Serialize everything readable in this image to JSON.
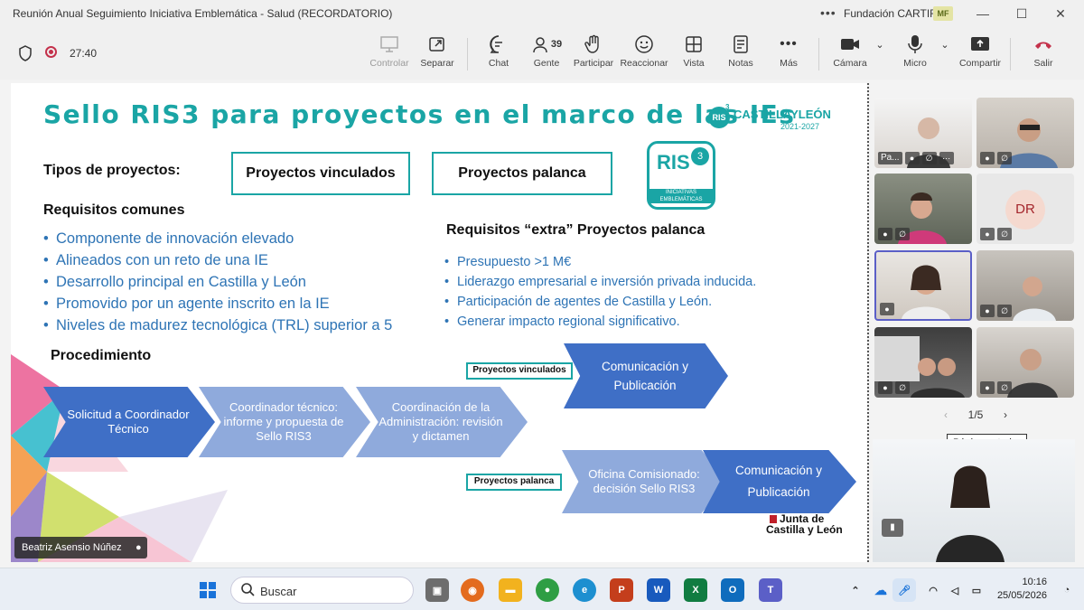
{
  "window": {
    "title": "Reunión Anual Seguimiento Iniciativa Emblemática - Salud (RECORDATORIO)",
    "more": "•••",
    "org": "Fundación CARTIF",
    "user_initials": "MF"
  },
  "meeting": {
    "timer": "27:40",
    "buttons": {
      "controlar": "Controlar",
      "separar": "Separar",
      "chat": "Chat",
      "gente": "Gente",
      "people_count": "39",
      "participar": "Participar",
      "reaccionar": "Reaccionar",
      "vista": "Vista",
      "notas": "Notas",
      "mas": "Más",
      "camara": "Cámara",
      "micro": "Micro",
      "compartir": "Compartir",
      "salir": "Salir"
    }
  },
  "slide": {
    "title": "Sello RIS3 para proyectos en el marco de las IEs",
    "logo_ris": "RIS",
    "logo_sup": "3",
    "logo_region": "CASTILLAYLEÓN",
    "logo_years": "2021-2027",
    "badge_ris": "RIS",
    "badge_three": "3",
    "badge_text": "INICIATIVAS EMBLEMÁTICAS",
    "tipos_label": "Tipos de proyectos:",
    "tipo_vinculados": "Proyectos vinculados",
    "tipo_palanca": "Proyectos palanca",
    "req_comunes_title": "Requisitos comunes",
    "req_comunes": [
      "Componente de innovación elevado",
      "Alineados con un reto de una IE",
      "Desarrollo principal en Castilla y León",
      "Promovido por un agente inscrito en la IE",
      "Niveles de madurez tecnológica (TRL) superior a 5"
    ],
    "req_extra_title": "Requisitos “extra” Proyectos palanca",
    "req_extra": [
      "Presupuesto >1 M€",
      "Liderazgo empresarial e inversión privada inducida.",
      "Participación de agentes de Castilla y León.",
      "Generar impacto regional significativo."
    ],
    "procedimiento": "Procedimiento",
    "step1": "Solicitud a Coordinador Técnico",
    "step2": "Coordinador técnico: informe y propuesta de Sello RIS3",
    "step3": "Coordinación de la Administración: revisión y dictamen",
    "tag_vinculados": "Proyectos vinculados",
    "tag_palanca": "Proyectos palanca",
    "step_com1": "Comunicación y Publicación",
    "step_oficina": "Oficina Comisionado: decisión Sello RIS3",
    "step_com2": "Comunicación y Publicación",
    "jcyl_line1": "Junta de",
    "jcyl_line2": "Castilla y León"
  },
  "speaker": "Beatriz Asensio Núñez",
  "gallery": {
    "tile1_label": "Pa...",
    "tile_dr": "DR",
    "pager": "1/5",
    "tooltip": "Página anterior"
  },
  "taskbar": {
    "search": "Buscar",
    "time": "10:16",
    "date": "25/05/2026"
  },
  "colors": {
    "teal": "#1aa5a5",
    "chevron_dark": "#3f6fc6",
    "chevron_light": "#8faadc",
    "bullet_blue": "#2e74b5",
    "leave_red": "#c4314b"
  }
}
